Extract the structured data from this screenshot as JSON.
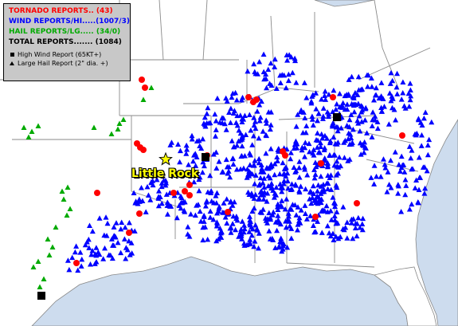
{
  "legend": {
    "tornado": "TORNADO REPORTS.. (43)",
    "wind": "WIND REPORTS/HI.....(1007/3)",
    "hail": "HAIL REPORTS/LG..... (34/0)",
    "total": "TOTAL REPORTS....... (1084)",
    "high_wind_key": "High Wind Report (65KT+)",
    "large_hail_key": "Large Hail Report (2\" dia. +)"
  },
  "city": {
    "name": "Little Rock"
  },
  "colors": {
    "tornado": "#ff0000",
    "wind": "#0000ff",
    "hail": "#00aa00",
    "land": "#ffffff",
    "water": "#cddcee",
    "borders": "#808080",
    "city_label": "#ffff00"
  },
  "icons": {
    "city_marker": "star-icon",
    "high_wind": "square-icon",
    "large_hail": "triangle-icon"
  }
}
